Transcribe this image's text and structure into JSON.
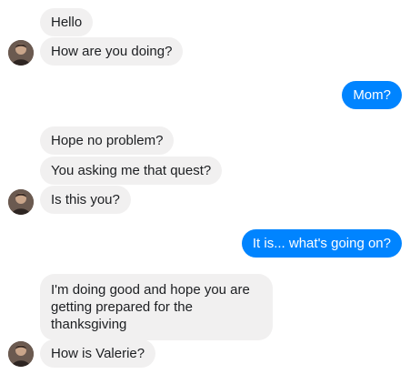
{
  "conversation": {
    "messages": [
      {
        "sender": "contact",
        "text": "Hello"
      },
      {
        "sender": "contact",
        "text": "How are you doing?"
      },
      {
        "sender": "me",
        "text": "Mom?"
      },
      {
        "sender": "contact",
        "text": "Hope no problem?"
      },
      {
        "sender": "contact",
        "text": "You asking me that quest?"
      },
      {
        "sender": "contact",
        "text": "Is this you?"
      },
      {
        "sender": "me",
        "text": "It is... what's going on?"
      },
      {
        "sender": "contact",
        "text": "I'm doing good and hope you are getting prepared for the thanksgiving"
      },
      {
        "sender": "contact",
        "text": "How is Valerie?"
      }
    ]
  },
  "colors": {
    "incoming_bubble": "#f1f0f0",
    "outgoing_bubble": "#0084ff",
    "incoming_text": "#1c1e21",
    "outgoing_text": "#ffffff"
  },
  "icons": {
    "avatar": "contact-avatar-photo"
  }
}
